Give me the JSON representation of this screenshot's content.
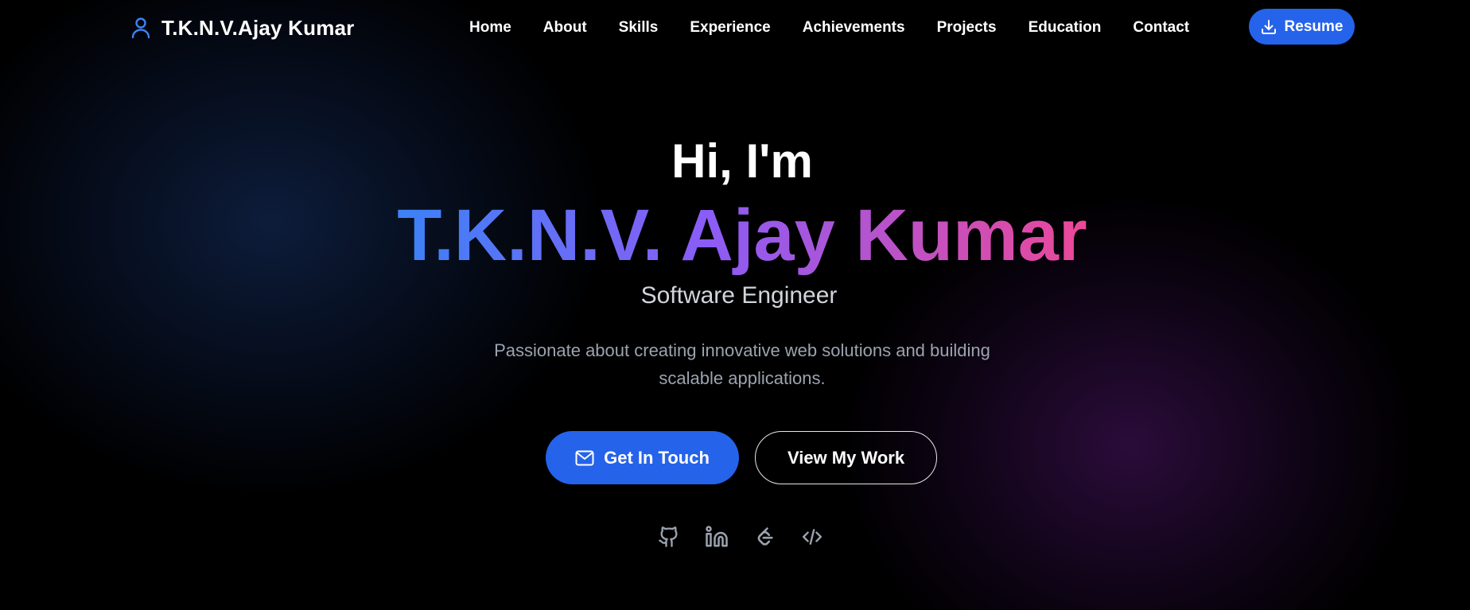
{
  "brand": {
    "name": "T.K.N.V.Ajay Kumar",
    "icon": "user-icon"
  },
  "nav": {
    "links": [
      "Home",
      "About",
      "Skills",
      "Experience",
      "Achievements",
      "Projects",
      "Education",
      "Contact"
    ],
    "resume_label": "Resume",
    "resume_icon": "download-icon"
  },
  "hero": {
    "greeting": "Hi, I'm",
    "name": "T.K.N.V. Ajay Kumar",
    "role": "Software Engineer",
    "description": "Passionate about creating innovative web solutions and building scalable applications.",
    "primary_cta": "Get In Touch",
    "primary_cta_icon": "mail-icon",
    "secondary_cta": "View My Work"
  },
  "socials": [
    "github-icon",
    "linkedin-icon",
    "leetcode-icon",
    "code-icon"
  ],
  "colors": {
    "accent": "#2563eb",
    "gradient_start": "#3b82f6",
    "gradient_mid": "#8b5cf6",
    "gradient_end": "#ec4899",
    "background": "#000000"
  }
}
